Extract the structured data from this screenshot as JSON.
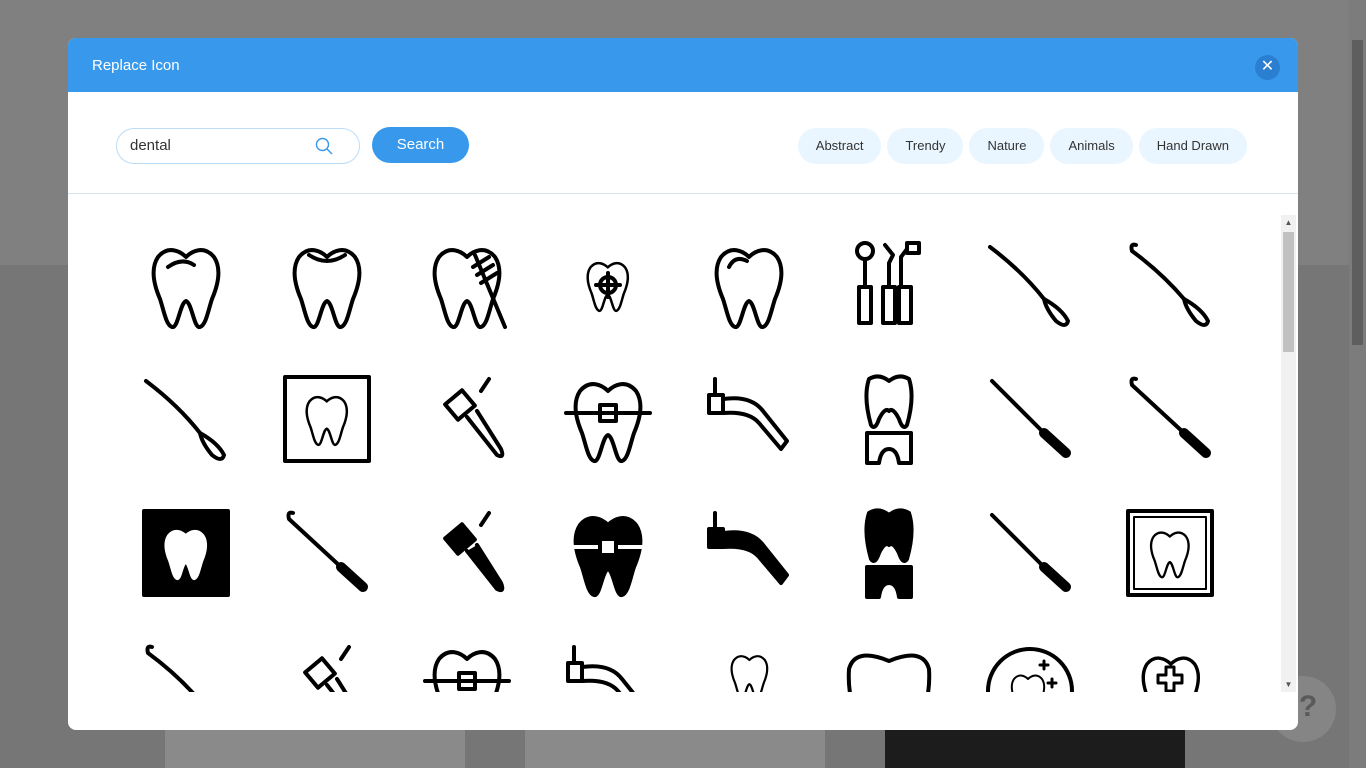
{
  "dialog": {
    "title": "Replace Icon",
    "close_icon": "close-icon"
  },
  "search": {
    "value": "dental",
    "button": "Search",
    "icon": "search-icon"
  },
  "categories": [
    "Abstract",
    "Trendy",
    "Nature",
    "Animals",
    "Hand Drawn"
  ],
  "colors": {
    "accent": "#3899ec",
    "tag_bg": "#eaf6ff"
  },
  "icons": [
    "tooth-outline",
    "tooth-filling",
    "tooth-brush",
    "tooth-target",
    "tooth-thin",
    "dental-tools",
    "probe",
    "probe-hook",
    "explorer",
    "tooth-xray",
    "drill",
    "braces",
    "saliva-ejector",
    "crown",
    "scaler",
    "scaler-hook",
    "tooth-xray-filled",
    "scaler-hook",
    "drill-filled",
    "braces-filled",
    "saliva-ejector-filled",
    "crown-filled",
    "scaler",
    "tooth-xray-frame",
    "probe-hook",
    "drill",
    "braces",
    "saliva-ejector",
    "tooth-small",
    "tooth-wide",
    "tooth-sparkle",
    "tooth-cross"
  ],
  "help": {
    "label": "?"
  }
}
